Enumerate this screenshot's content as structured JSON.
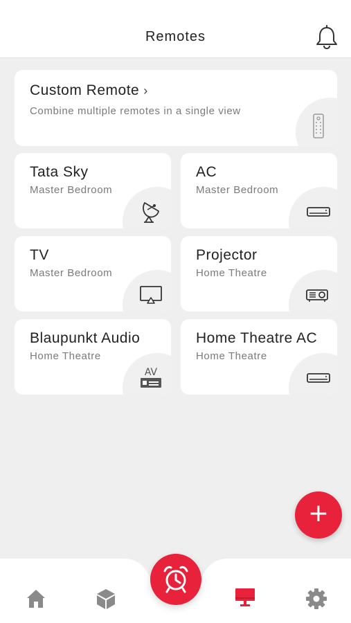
{
  "header": {
    "title": "Remotes"
  },
  "custom_remote": {
    "title": "Custom Remote",
    "chevron": "›",
    "description": "Combine multiple remotes in a single view",
    "icon": "remote-icon"
  },
  "remotes": [
    {
      "name": "Tata Sky",
      "room": "Master Bedroom",
      "icon": "satellite-dish-icon"
    },
    {
      "name": "AC",
      "room": "Master Bedroom",
      "icon": "ac-icon"
    },
    {
      "name": "TV",
      "room": "Master Bedroom",
      "icon": "tv-icon"
    },
    {
      "name": "Projector",
      "room": "Home Theatre",
      "icon": "projector-icon"
    },
    {
      "name": "Blaupunkt Audio",
      "room": "Home Theatre",
      "icon": "av-receiver-icon",
      "icon_text": "AV"
    },
    {
      "name": "Home Theatre AC",
      "room": "Home Theatre",
      "icon": "ac-icon"
    }
  ],
  "fab": {
    "label": "+"
  },
  "nav": [
    {
      "name": "home",
      "icon": "home-icon",
      "active": false
    },
    {
      "name": "devices",
      "icon": "cube-icon",
      "active": false
    },
    {
      "name": "alarm",
      "icon": "alarm-clock-icon",
      "active": false
    },
    {
      "name": "remotes",
      "icon": "monitor-icon",
      "active": true
    },
    {
      "name": "settings",
      "icon": "gear-icon",
      "active": false
    }
  ],
  "colors": {
    "accent": "#e8223a",
    "inactive_icon": "#8a8a8a",
    "background": "#efefef"
  }
}
